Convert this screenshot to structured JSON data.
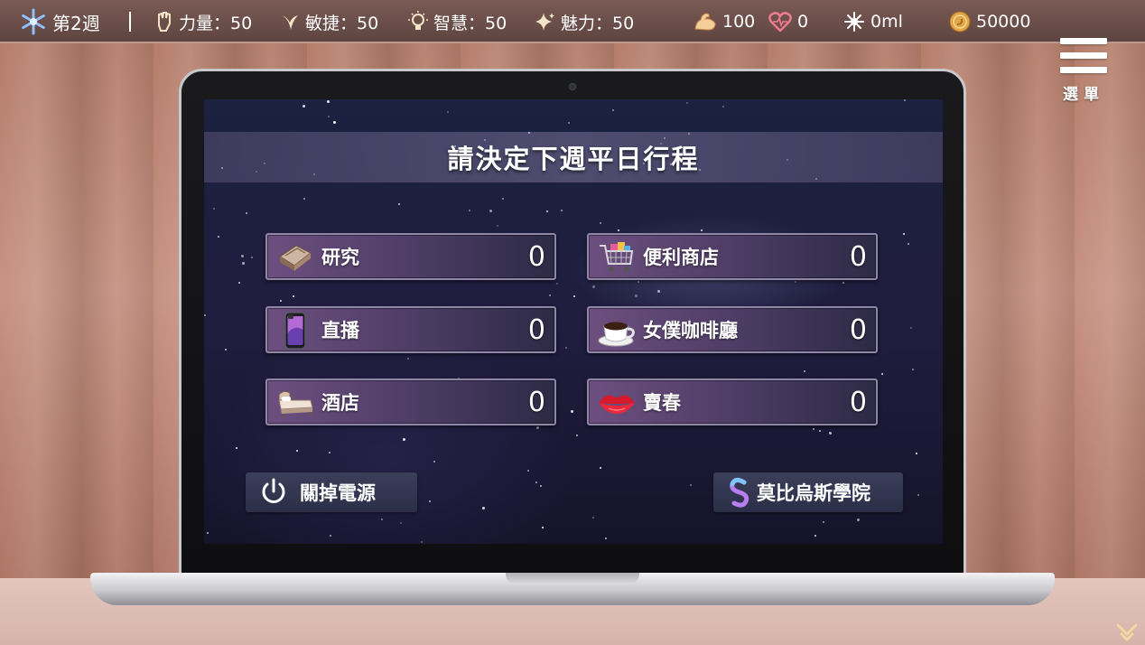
{
  "status_bar": {
    "week": "第2週",
    "stats": [
      {
        "icon": "strength-fist-icon",
        "text": "力量：50"
      },
      {
        "icon": "agility-wing-icon",
        "text": "敏捷：50"
      },
      {
        "icon": "wisdom-bulb-icon",
        "text": "智慧：50"
      },
      {
        "icon": "charm-sparkle-icon",
        "text": "魅力：50"
      }
    ],
    "stamina": "100",
    "affection": "0",
    "fluid": "0ml",
    "money": "50000"
  },
  "menu": {
    "label": "選單"
  },
  "schedule": {
    "title": "請決定下週平日行程",
    "activities": [
      {
        "icon": "book-icon",
        "label": "研究",
        "count": "0"
      },
      {
        "icon": "shopping-cart-icon",
        "label": "便利商店",
        "count": "0"
      },
      {
        "icon": "smartphone-icon",
        "label": "直播",
        "count": "0"
      },
      {
        "icon": "coffee-cup-icon",
        "label": "女僕咖啡廳",
        "count": "0"
      },
      {
        "icon": "hotel-bed-icon",
        "label": "酒店",
        "count": "0"
      },
      {
        "icon": "lips-icon",
        "label": "賣春",
        "count": "0"
      }
    ],
    "power_off_label": "關掉電源",
    "academy_label": "莫比烏斯學院"
  },
  "colors": {
    "panel_accent": "#6d4f7f",
    "topbar": "#5e4540",
    "money_coin": "#e2a64a",
    "heart": "#e0667a"
  }
}
